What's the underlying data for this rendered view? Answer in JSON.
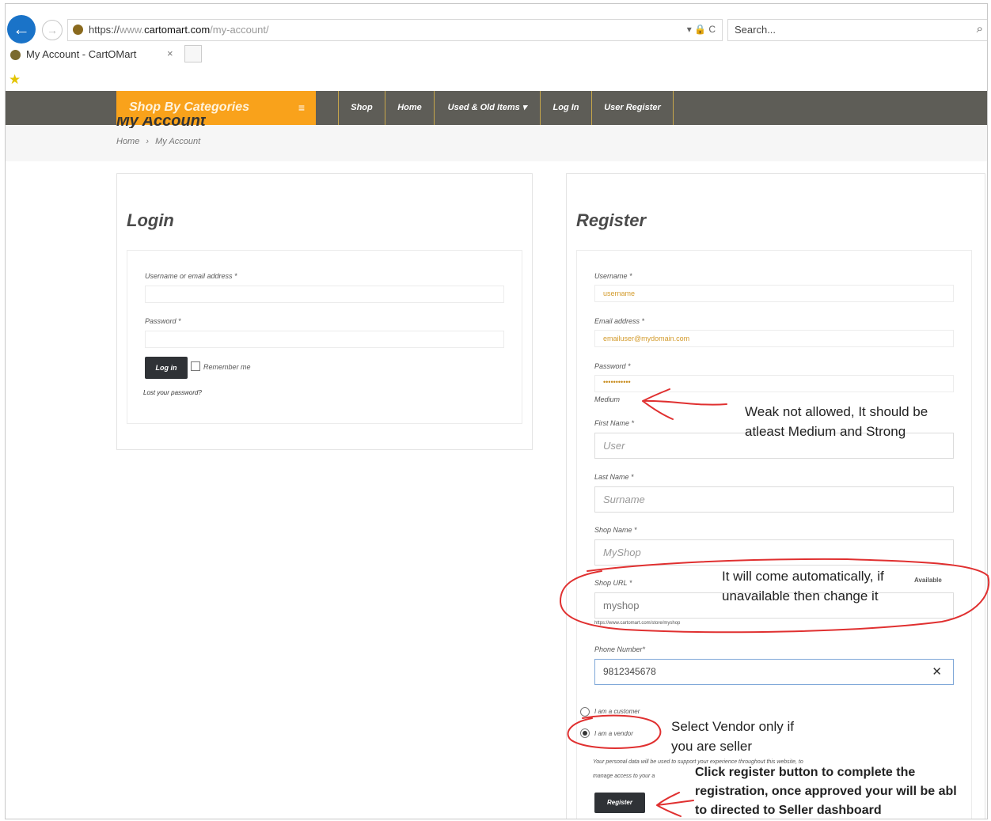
{
  "browser": {
    "url_scheme": "https://",
    "url_prefix": "www.",
    "url_domain": "cartomart.com",
    "url_path": "/my-account/",
    "url_tools": "▾ 🔒 C",
    "search_placeholder": "Search...",
    "tab_title": "My Account - CartOMart",
    "tab_close": "×"
  },
  "nav": {
    "categories_label": "Shop By Categories",
    "items": [
      "Shop",
      "Home",
      "Used & Old Items ▾",
      "Log In",
      "User Register"
    ]
  },
  "page": {
    "title": "My Account",
    "breadcrumb": [
      "Home",
      "›",
      "My Account"
    ]
  },
  "login": {
    "title": "Login",
    "username_label": "Username or email address *",
    "password_label": "Password *",
    "login_button": "Log in",
    "remember_label": "Remember me",
    "lost_password": "Lost your password?"
  },
  "register": {
    "title": "Register",
    "username_label": "Username *",
    "username_value": "username",
    "email_label": "Email address *",
    "email_value": "emailuser@mydomain.com",
    "password_label": "Password *",
    "password_value": "•••••••••••",
    "strength": "Medium",
    "first_name_label": "First Name *",
    "first_name_placeholder": "User",
    "last_name_label": "Last Name *",
    "last_name_placeholder": "Surname",
    "shop_name_label": "Shop Name *",
    "shop_name_placeholder": "MyShop",
    "shop_url_label": "Shop URL *",
    "shop_url_status": "Available",
    "shop_url_value": "myshop",
    "shop_url_hint": "https://www.cartomart.com/store/myshop",
    "phone_label": "Phone Number*",
    "phone_value": "9812345678",
    "clear_symbol": "✕",
    "customer_option": "I am a customer",
    "vendor_option": "I am a vendor",
    "privacy_text_1": "Your personal data will be used to support your experience throughout this website, to",
    "privacy_text_2": "manage access to your a",
    "register_button": "Register"
  },
  "annotations": {
    "note_password_1": "Weak not allowed, It should be",
    "note_password_2": "atleast Medium and Strong",
    "note_url_1": "It will come automatically, if",
    "note_url_2": "unavailable then change it",
    "note_vendor_1": "Select Vendor only if",
    "note_vendor_2": "you are seller",
    "note_register_1": "Click register button to complete the",
    "note_register_2": "registration, once approved your will be abl",
    "note_register_3": "to directed to Seller dashboard",
    "ink_color": "#e03030"
  },
  "colors": {
    "nav_bg": "#5e5d57",
    "category_accent": "#f9a21b",
    "browser_back": "#1a73c8",
    "input_value": "#d39b2c",
    "dark_button": "#2f3236"
  }
}
